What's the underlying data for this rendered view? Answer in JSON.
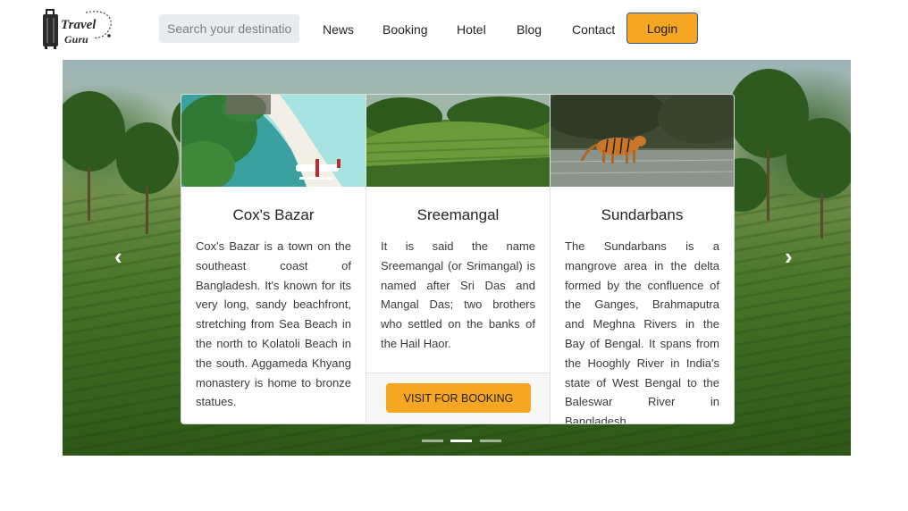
{
  "header": {
    "logo": {
      "line1": "Travel",
      "line2": "Guru"
    },
    "search": {
      "placeholder": "Search your destination"
    },
    "nav": [
      {
        "label": "News"
      },
      {
        "label": "Booking"
      },
      {
        "label": "Hotel"
      },
      {
        "label": "Blog"
      },
      {
        "label": "Contact"
      }
    ],
    "login_label": "Login"
  },
  "carousel": {
    "prev_icon": "chevron-left-icon",
    "next_icon": "chevron-right-icon",
    "indicator_count": 3,
    "active_indicator": 2,
    "cards": [
      {
        "title": "Cox's Bazar",
        "text": "Cox's Bazar is a town on the southeast coast of Bangladesh. It's known for its very long, sandy beachfront, stretching from Sea Beach in the north to Kolatoli Beach in the south. Aggameda Khyang monastery is home to bronze statues."
      },
      {
        "title": "Sreemangal",
        "text": "It is said the name Sreemangal (or Srimangal) is named after Sri Das and Mangal Das; two brothers who settled on the banks of the Hail Haor.",
        "button_label": "VISIT FOR BOOKING"
      },
      {
        "title": "Sundarbans",
        "text": "The Sundarbans is a mangrove area in the delta formed by the confluence of the Ganges, Brahmaputra and Meghna Rivers in the Bay of Bengal. It spans from the Hooghly River in India's state of West Bengal to the Baleswar River in Bangladesh."
      }
    ]
  },
  "colors": {
    "accent": "#f5a623",
    "login_border": "#2a5aa8"
  }
}
